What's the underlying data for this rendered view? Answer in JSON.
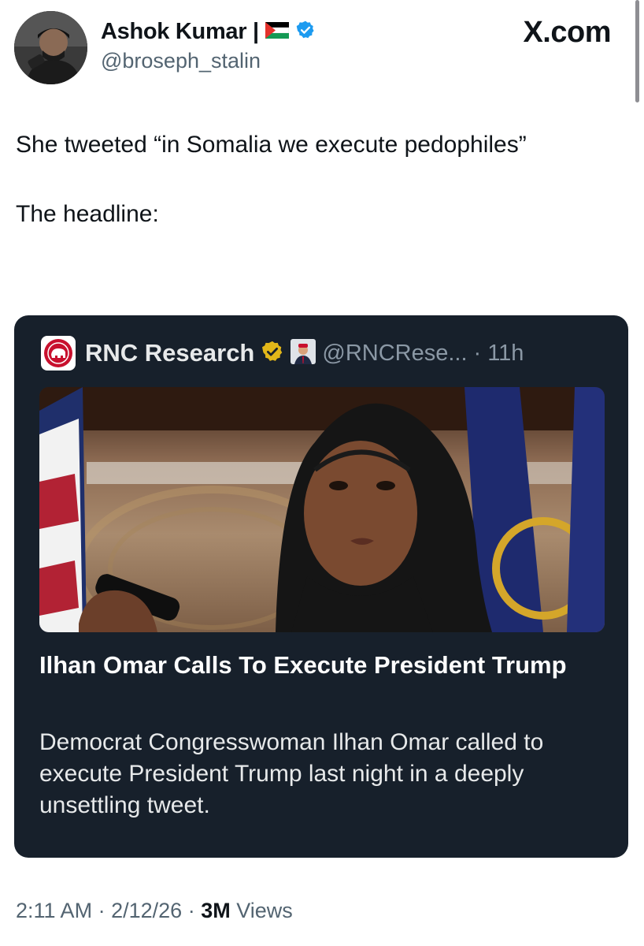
{
  "author": {
    "name": "Ashok Kumar |",
    "handle": "@broseph_stalin",
    "verified_color": "#1d9bf0"
  },
  "brand": "X.com",
  "tweet": {
    "line1": "She tweeted “in Somalia we execute pedophiles”",
    "line2": "The headline:"
  },
  "embed": {
    "author_name": "RNC Research",
    "author_handle": "@RNCRese...",
    "separator": "·",
    "time": "11h",
    "badge_color": "#e2b719",
    "headline": "Ilhan Omar Calls To Execute President Trump",
    "summary": "Democrat Congresswoman Ilhan Omar called to execute President Trump last night in a deeply unsettling tweet."
  },
  "meta": {
    "time": "2:11 AM",
    "sep1": "·",
    "date": "2/12/26",
    "sep2": "·",
    "views_count": "3M",
    "views_label": "Views"
  }
}
